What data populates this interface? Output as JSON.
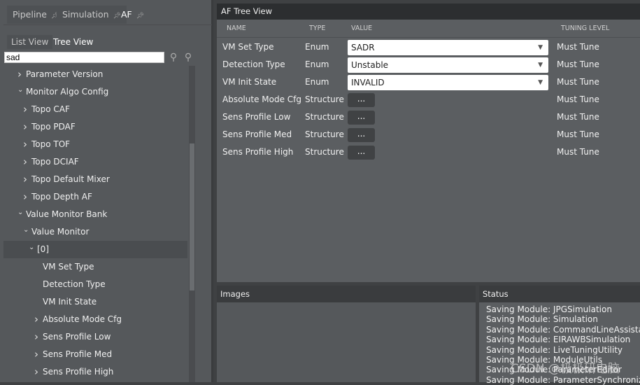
{
  "tabs": [
    {
      "label": "Pipeline",
      "active": false
    },
    {
      "label": "Simulation",
      "active": false
    },
    {
      "label": "AF",
      "active": true
    }
  ],
  "view_tabs": {
    "list": "List View",
    "tree": "Tree View"
  },
  "search": {
    "value": "sad"
  },
  "tree": [
    {
      "label": "Parameter Version",
      "level": 0,
      "expanded": false
    },
    {
      "label": "Monitor Algo Config",
      "level": 0,
      "expanded": true
    },
    {
      "label": "Topo CAF",
      "level": 1,
      "expanded": false
    },
    {
      "label": "Topo PDAF",
      "level": 1,
      "expanded": false
    },
    {
      "label": "Topo TOF",
      "level": 1,
      "expanded": false
    },
    {
      "label": "Topo DCIAF",
      "level": 1,
      "expanded": false
    },
    {
      "label": "Topo Default Mixer",
      "level": 1,
      "expanded": false
    },
    {
      "label": "Topo Depth AF",
      "level": 1,
      "expanded": false
    },
    {
      "label": "Value Monitor Bank",
      "level": 0,
      "expanded": true
    },
    {
      "label": "Value Monitor",
      "level": 1,
      "expanded": true
    },
    {
      "label": "[0]",
      "level": 2,
      "expanded": true,
      "selected": true
    },
    {
      "label": "VM Set Type",
      "level": 3,
      "leaf": true
    },
    {
      "label": "Detection Type",
      "level": 3,
      "leaf": true
    },
    {
      "label": "VM Init State",
      "level": 3,
      "leaf": true
    },
    {
      "label": "Absolute Mode Cfg",
      "level": 3,
      "expanded": false
    },
    {
      "label": "Sens Profile Low",
      "level": 3,
      "expanded": false
    },
    {
      "label": "Sens Profile Med",
      "level": 3,
      "expanded": false
    },
    {
      "label": "Sens Profile High",
      "level": 3,
      "expanded": false
    }
  ],
  "main": {
    "title": "AF Tree View",
    "columns": {
      "name": "NAME",
      "type": "TYPE",
      "value": "VALUE",
      "tuning": "TUNING LEVEL"
    },
    "rows": [
      {
        "name": "VM Set Type",
        "type": "Enum",
        "value": "SADR",
        "kind": "dropdown",
        "tuning": "Must Tune"
      },
      {
        "name": "Detection Type",
        "type": "Enum",
        "value": "Unstable",
        "kind": "dropdown",
        "tuning": "Must Tune"
      },
      {
        "name": "VM Init State",
        "type": "Enum",
        "value": "INVALID",
        "kind": "dropdown",
        "tuning": "Must Tune"
      },
      {
        "name": "Absolute Mode Cfg",
        "type": "Structure",
        "value": "...",
        "kind": "button",
        "tuning": "Must Tune"
      },
      {
        "name": "Sens Profile Low",
        "type": "Structure",
        "value": "...",
        "kind": "button",
        "tuning": "Must Tune"
      },
      {
        "name": "Sens Profile Med",
        "type": "Structure",
        "value": "...",
        "kind": "button",
        "tuning": "Must Tune"
      },
      {
        "name": "Sens Profile High",
        "type": "Structure",
        "value": "...",
        "kind": "button",
        "tuning": "Must Tune"
      }
    ]
  },
  "images": {
    "title": "Images"
  },
  "status": {
    "title": "Status",
    "lines": [
      "Saving Module: JPGSimulation",
      "Saving Module: Simulation",
      "Saving Module: CommandLineAssistant",
      "Saving Module: EIRAWBSimulation",
      "Saving Module: LiveTuningUtility",
      "Saving Module: ModuleUtils",
      "Saving Module: ParameterEditor",
      "Saving Module: ParameterSynchronization"
    ]
  },
  "watermark": "CSDN @极极研电脑"
}
